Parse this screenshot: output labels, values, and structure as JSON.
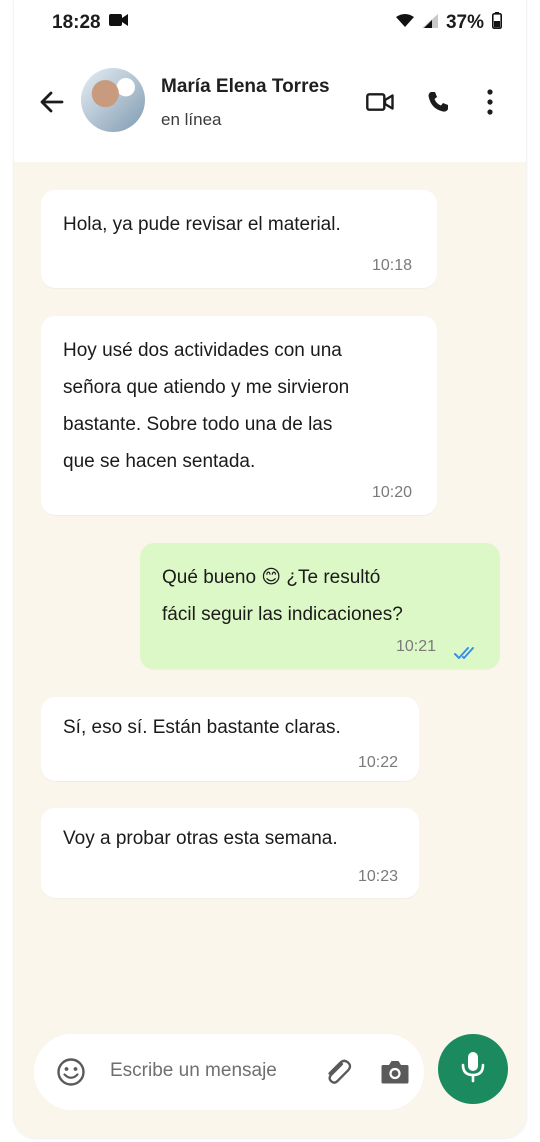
{
  "status_bar": {
    "time": "18:28",
    "battery": "37%"
  },
  "header": {
    "contact_name": "María Elena Torres",
    "contact_status": "en línea",
    "icons": [
      "back-arrow-icon",
      "avatar",
      "video-call-icon",
      "phone-icon",
      "more-options-icon"
    ]
  },
  "messages": [
    {
      "direction": "incoming",
      "text": "Hola, ya pude revisar el material.",
      "time": "10:18"
    },
    {
      "direction": "incoming",
      "text": "Hoy usé dos actividades con una\nseñora que atiendo y me sirvieron\nbastante. Sobre todo una de las\nque se hacen sentada.",
      "time": "10:20"
    },
    {
      "direction": "outgoing",
      "text": "Qué bueno 😊 ¿Te resultó\nfácil seguir las indicaciones?",
      "time": "10:21",
      "read_status": "read"
    },
    {
      "direction": "incoming",
      "text": "Sí, eso sí. Están bastante claras.",
      "time": "10:22"
    },
    {
      "direction": "incoming",
      "text": "Voy a probar otras esta semana.",
      "time": "10:23"
    }
  ],
  "composer": {
    "placeholder": "Escribe un mensaje",
    "icons": [
      "emoji-icon",
      "attach-icon",
      "camera-icon",
      "mic-icon"
    ]
  },
  "colors": {
    "chat_background": "#fbf6ec",
    "incoming_bubble": "#ffffff",
    "outgoing_bubble": "#dcf8c6",
    "mic_button": "#1b8a5e",
    "read_ticks": "#3b8ee8"
  }
}
